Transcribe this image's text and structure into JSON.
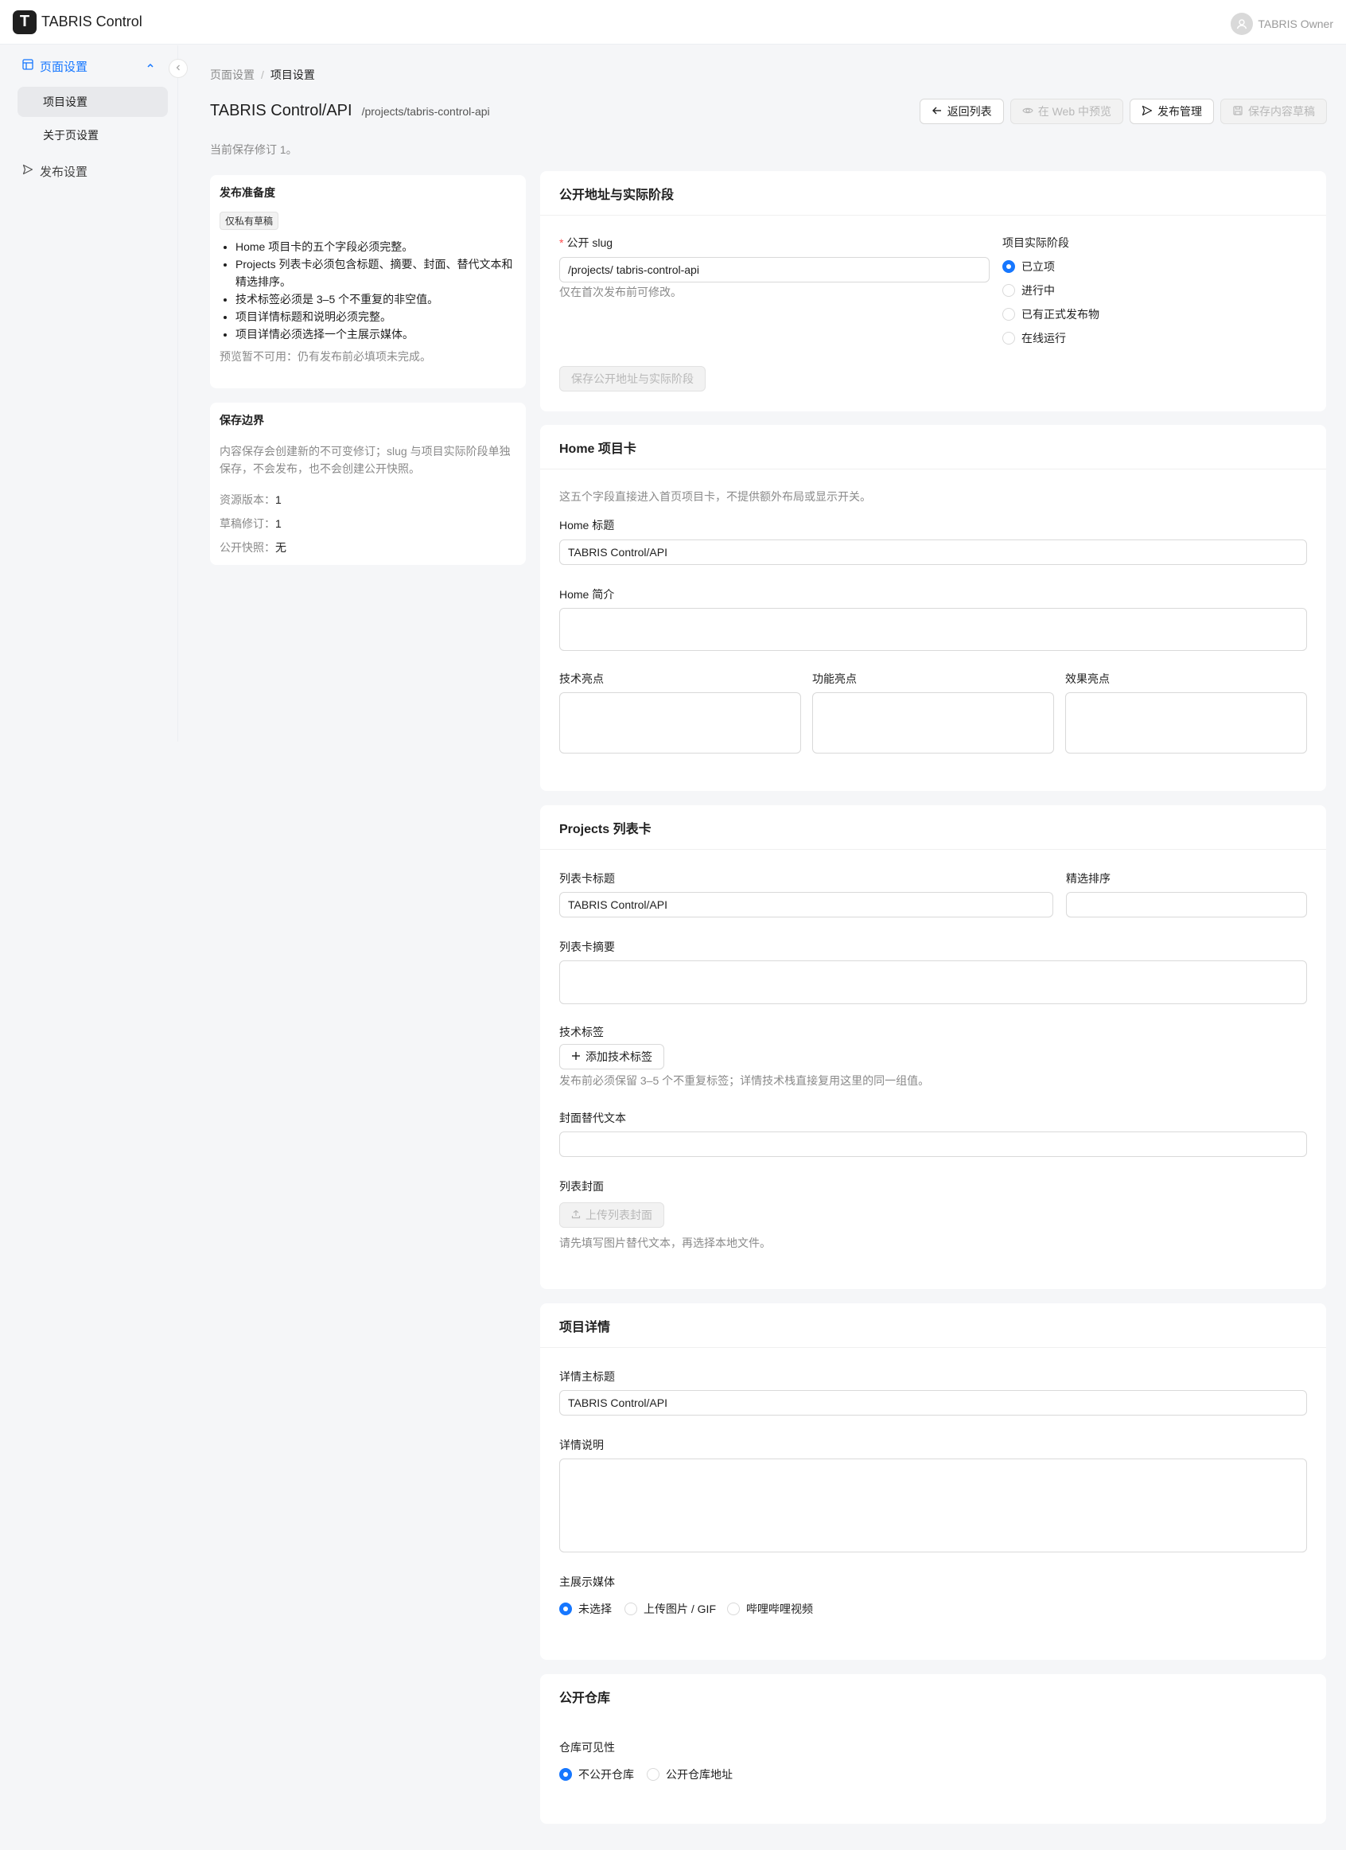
{
  "app": {
    "logo_letter": "T",
    "title": "TABRIS Control",
    "user": "TABRIS Owner"
  },
  "sidebar": {
    "group_label": "页面设置",
    "items": [
      {
        "label": "项目设置"
      },
      {
        "label": "关于页设置"
      }
    ],
    "publish_label": "发布设置"
  },
  "breadcrumb": {
    "parent": "页面设置",
    "sep": "/",
    "current": "项目设置"
  },
  "page": {
    "title": "TABRIS Control/API",
    "path": "/projects/tabris-control-api",
    "revision_text": "当前保存修订 1。"
  },
  "toolbar": {
    "back_label": "返回列表",
    "preview_label": "在 Web 中预览",
    "publish_label": "发布管理",
    "save_label": "保存内容草稿"
  },
  "readiness": {
    "title": "发布准备度",
    "tag": "仅私有草稿",
    "items": [
      "Home 项目卡的五个字段必须完整。",
      "Projects 列表卡必须包含标题、摘要、封面、替代文本和",
      "精选排序。",
      "技术标签必须是 3–5 个不重复的非空值。",
      "项目详情标题和说明必须完整。",
      "项目详情必须选择一个主展示媒体。"
    ],
    "note": "预览暂不可用：仍有发布前必填项未完成。"
  },
  "boundary": {
    "title": "保存边界",
    "desc_line1": "内容保存会创建新的不可变修订；slug 与项目实际阶段单独",
    "desc_line2": "保存，不会发布，也不会创建公开快照。",
    "resource_version_label": "资源版本：",
    "resource_version": "1",
    "draft_revision_label": "草稿修订：",
    "draft_revision": "1",
    "public_snapshot_label": "公开快照：",
    "public_snapshot": "无"
  },
  "public_address": {
    "title": "公开地址与实际阶段",
    "slug_label": "公开 slug",
    "slug_value": "/projects/ tabris-control-api",
    "slug_help": "仅在首次发布前可修改。",
    "stage_label": "项目实际阶段",
    "stages": [
      {
        "label": "已立项",
        "selected": true
      },
      {
        "label": "进行中",
        "selected": false
      },
      {
        "label": "已有正式发布物",
        "selected": false
      },
      {
        "label": "在线运行",
        "selected": false
      }
    ],
    "save_label": "保存公开地址与实际阶段"
  },
  "home_card": {
    "title": "Home 项目卡",
    "desc": "这五个字段直接进入首页项目卡，不提供额外布局或显示开关。",
    "title_label": "Home 标题",
    "title_value": "TABRIS Control/API",
    "summary_label": "Home 简介",
    "tech_label": "技术亮点",
    "feature_label": "功能亮点",
    "effect_label": "效果亮点"
  },
  "list_card": {
    "title": "Projects 列表卡",
    "card_title_label": "列表卡标题",
    "card_title_value": "TABRIS Control/API",
    "featured_order_label": "精选排序",
    "summary_label": "列表卡摘要",
    "tags_label": "技术标签",
    "add_tag_label": "添加技术标签",
    "tags_help": "发布前必须保留 3–5 个不重复标签；详情技术栈直接复用这里的同一组值。",
    "cover_alt_label": "封面替代文本",
    "cover_label": "列表封面",
    "upload_cover_label": "上传列表封面",
    "cover_help": "请先填写图片替代文本，再选择本地文件。"
  },
  "detail": {
    "title": "项目详情",
    "main_title_label": "详情主标题",
    "main_title_value": "TABRIS Control/API",
    "desc_label": "详情说明",
    "media_label": "主展示媒体",
    "media_options": [
      {
        "label": "未选择",
        "selected": true
      },
      {
        "label": "上传图片 / GIF",
        "selected": false
      },
      {
        "label": "哔哩哔哩视频",
        "selected": false
      }
    ]
  },
  "repo": {
    "title": "公开仓库",
    "visibility_label": "仓库可见性",
    "options": [
      {
        "label": "不公开仓库",
        "selected": true
      },
      {
        "label": "公开仓库地址",
        "selected": false
      }
    ]
  },
  "colors": {
    "accent": "#1677ff",
    "required": "#ff4d4f",
    "muted": "#8a8a8a"
  }
}
